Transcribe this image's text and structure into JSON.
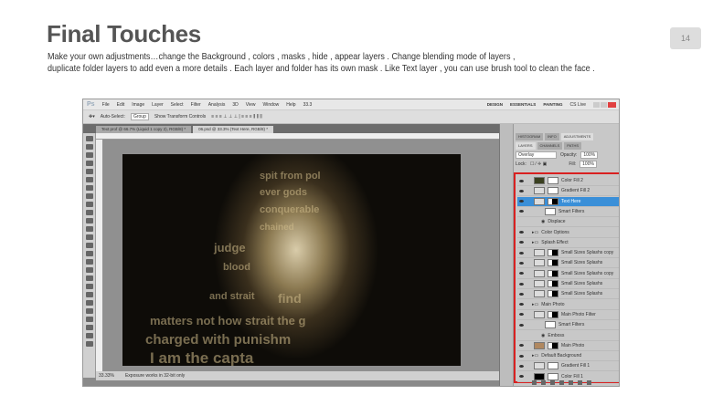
{
  "slide": {
    "title": "Final Touches",
    "page_number": "14",
    "description": [
      "Make your own adjustments…change the Background , colors , masks , hide , appear  layers . Change blending mode of layers ,",
      "duplicate folder layers to add even  a more details . Each layer and folder has its own mask . Like Text layer , you can use brush tool to clean the face ."
    ]
  },
  "app": {
    "logo": "Ps",
    "menu": [
      "File",
      "Edit",
      "Image",
      "Layer",
      "Select",
      "Filter",
      "Analysis",
      "3D",
      "View",
      "Window",
      "Help"
    ],
    "zoom": "33.3",
    "workspaces": [
      "DESIGN",
      "ESSENTIALS",
      "PAINTING"
    ],
    "cslive": "CS Live"
  },
  "options": {
    "auto_select": "Auto-Select:",
    "group": "Group",
    "transform": "Show Transform Controls"
  },
  "doc_tabs": [
    "Text prof @ 66.7% (Liquid 1 copy 2), RGB/8) *",
    "06.psd @ 33.3% (Text Here, RGB/8) *"
  ],
  "image_text": [
    "spit from pol",
    "ever gods",
    "conquerable",
    "chained",
    "judge",
    "blood",
    "and strait",
    "find",
    "matters not how strait the g",
    "charged with punishm",
    "I am the capta"
  ],
  "status": {
    "zoom": "33.33%",
    "message": "Exposure works in 32-bit only"
  },
  "panel": {
    "top_tabs": [
      "HISTOGRAM",
      "INFO",
      "ADJUSTMENTS"
    ],
    "tabs": [
      "LAYERS",
      "CHANNELS",
      "PATHS"
    ],
    "blend_mode": "Overlay",
    "opacity_label": "Opacity:",
    "opacity": "100%",
    "lock_label": "Lock:",
    "fill_label": "Fill:",
    "fill": "100%",
    "layers": [
      {
        "name": "Color Fill 2",
        "kind": "layer"
      },
      {
        "name": "Gradient Fill 2",
        "kind": "layer"
      },
      {
        "name": "Text Here",
        "kind": "layer",
        "selected": true
      },
      {
        "name": "Smart Filters",
        "kind": "sub"
      },
      {
        "name": "Displace",
        "kind": "filter"
      },
      {
        "name": "Color Options",
        "kind": "group"
      },
      {
        "name": "Splash Effect",
        "kind": "group"
      },
      {
        "name": "Small Sizes Splashs copy",
        "kind": "layer"
      },
      {
        "name": "Small Sizes Splashs",
        "kind": "layer"
      },
      {
        "name": "Small Sizes Splashs copy",
        "kind": "layer"
      },
      {
        "name": "Small Sizes Splashs",
        "kind": "layer"
      },
      {
        "name": "Small Sizes Splashs",
        "kind": "layer"
      },
      {
        "name": "Main Photo",
        "kind": "group"
      },
      {
        "name": "Main Photo Filter",
        "kind": "layer"
      },
      {
        "name": "Smart Filters",
        "kind": "sub"
      },
      {
        "name": "Emboss",
        "kind": "filter"
      },
      {
        "name": "Main Photo",
        "kind": "layer"
      },
      {
        "name": "Default Background",
        "kind": "group"
      },
      {
        "name": "Gradient Fill 1",
        "kind": "layer"
      },
      {
        "name": "Color Fill 1",
        "kind": "layer"
      }
    ]
  }
}
